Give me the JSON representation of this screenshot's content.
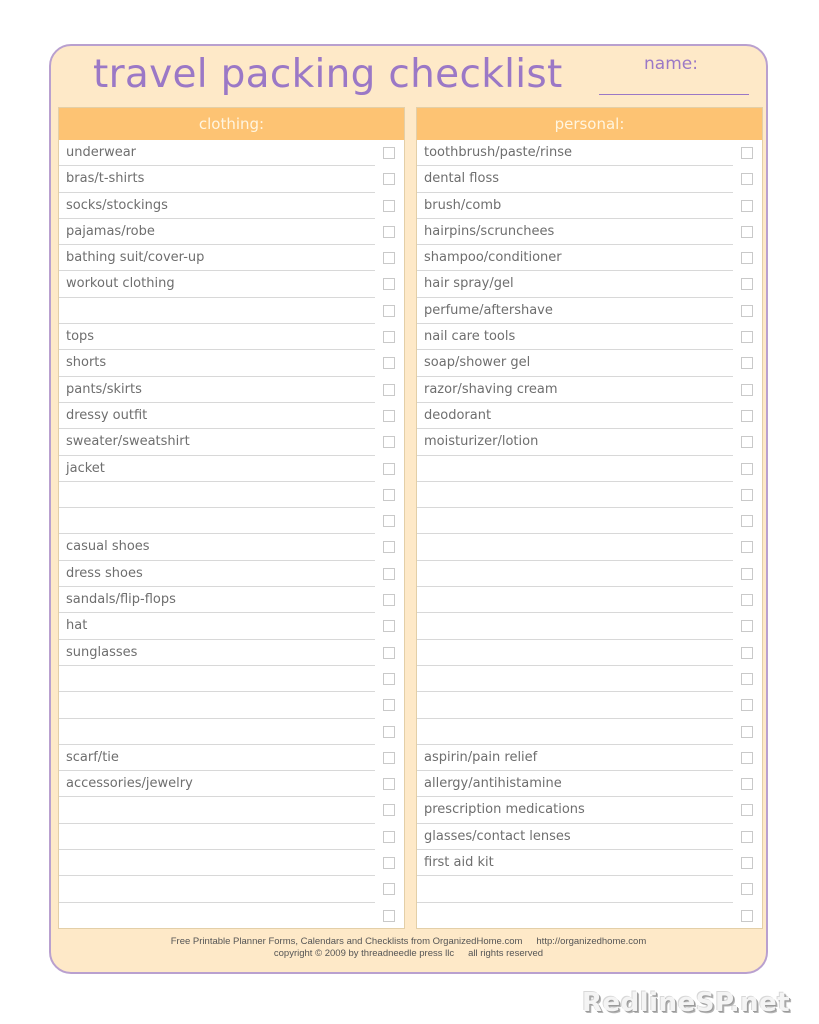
{
  "title": "travel packing checklist",
  "name_label": "name:",
  "name_value": "",
  "columns": [
    {
      "header": "clothing:",
      "rows": [
        "underwear",
        "bras/t-shirts",
        "socks/stockings",
        "pajamas/robe",
        "bathing suit/cover-up",
        "workout clothing",
        "",
        "tops",
        "shorts",
        "pants/skirts",
        "dressy outfit",
        "sweater/sweatshirt",
        "jacket",
        "",
        "",
        "casual shoes",
        "dress shoes",
        "sandals/flip-flops",
        "hat",
        "sunglasses",
        "",
        "",
        "",
        "scarf/tie",
        "accessories/jewelry",
        "",
        "",
        "",
        "",
        ""
      ]
    },
    {
      "header": "personal:",
      "rows": [
        "toothbrush/paste/rinse",
        "dental floss",
        "brush/comb",
        "hairpins/scrunchees",
        "shampoo/conditioner",
        "hair spray/gel",
        "perfume/aftershave",
        "nail care tools",
        "soap/shower gel",
        "razor/shaving cream",
        "deodorant",
        "moisturizer/lotion",
        "",
        "",
        "",
        "",
        "",
        "",
        "",
        "",
        "",
        "",
        "",
        "aspirin/pain relief",
        "allergy/antihistamine",
        "prescription medications",
        "glasses/contact lenses",
        "first aid kit",
        "",
        ""
      ]
    }
  ],
  "footer": {
    "line1_a": "Free Printable Planner Forms, Calendars and Checklists from OrganizedHome.com",
    "line1_b": "http://organizedhome.com",
    "line2_a": "copyright © 2009 by threadneedle press llc",
    "line2_b": "all rights reserved"
  },
  "watermark": "RedlineSP.net",
  "colors": {
    "accent_purple": "#9b78c6",
    "header_orange": "#fdc373",
    "sheet_background": "#fee9c8",
    "border_purple": "#b9a0cf"
  }
}
